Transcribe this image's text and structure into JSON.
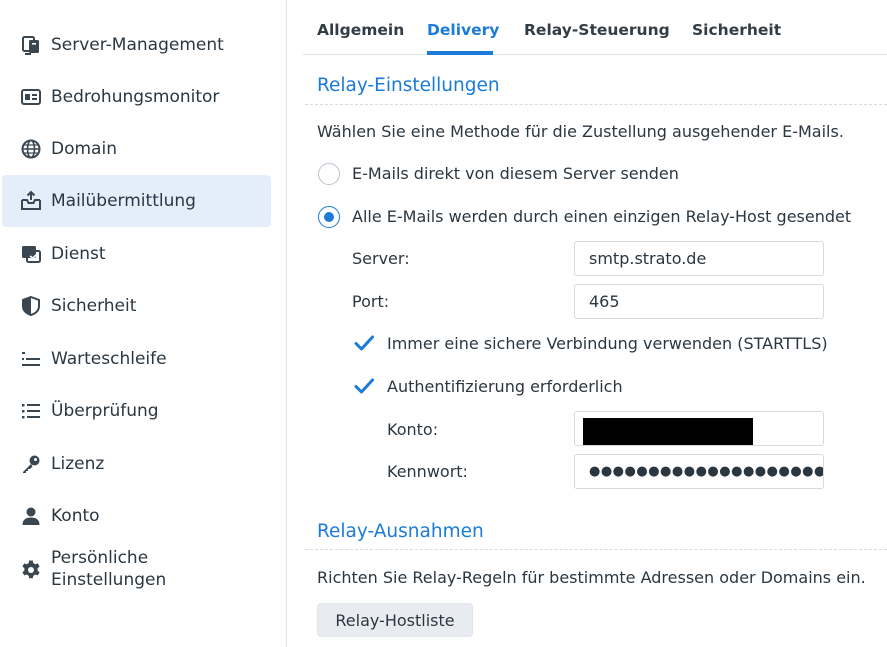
{
  "sidebar": {
    "items": [
      {
        "label": "Server-Management",
        "icon": "server-icon"
      },
      {
        "label": "Bedrohungsmonitor",
        "icon": "monitor-card-icon"
      },
      {
        "label": "Domain",
        "icon": "globe-icon"
      },
      {
        "label": "Mailübermittlung",
        "icon": "mail-tray-icon",
        "active": true
      },
      {
        "label": "Dienst",
        "icon": "service-icon"
      },
      {
        "label": "Sicherheit",
        "icon": "shield-icon"
      },
      {
        "label": "Warteschleife",
        "icon": "queue-list-icon"
      },
      {
        "label": "Überprüfung",
        "icon": "checklist-icon"
      },
      {
        "label": "Lizenz",
        "icon": "key-icon"
      },
      {
        "label": "Konto",
        "icon": "user-icon"
      },
      {
        "label_line1": "Persönliche",
        "label_line2": "Einstellungen",
        "icon": "gear-icon"
      }
    ]
  },
  "tabs": [
    {
      "label": "Allgemein"
    },
    {
      "label": "Delivery",
      "active": true
    },
    {
      "label": "Relay-Steuerung"
    },
    {
      "label": "Sicherheit"
    }
  ],
  "relay_settings": {
    "title": "Relay-Einstellungen",
    "description": "Wählen Sie eine Methode für die Zustellung ausgehender E-Mails.",
    "option_direct": "E-Mails direkt von diesem Server senden",
    "option_relay": "Alle E-Mails werden durch einen einzigen Relay-Host gesendet",
    "selected_option": "relay",
    "server_label": "Server:",
    "server_value": "smtp.strato.de",
    "port_label": "Port:",
    "port_value": "465",
    "starttls_label": "Immer eine sichere Verbindung verwenden (STARTTLS)",
    "starttls_checked": true,
    "auth_label": "Authentifizierung erforderlich",
    "auth_checked": true,
    "account_label": "Konto:",
    "password_label": "Kennwort:",
    "password_value": "●●●●●●●●●●●●●●●●●●●●●●"
  },
  "relay_exceptions": {
    "title": "Relay-Ausnahmen",
    "description": "Richten Sie Relay-Regeln für bestimmte Adressen oder Domains ein.",
    "button_label": "Relay-Hostliste"
  },
  "colors": {
    "accent": "#1a7bd8",
    "active_nav_bg": "#e3eefa",
    "icon": "#3b4750"
  }
}
